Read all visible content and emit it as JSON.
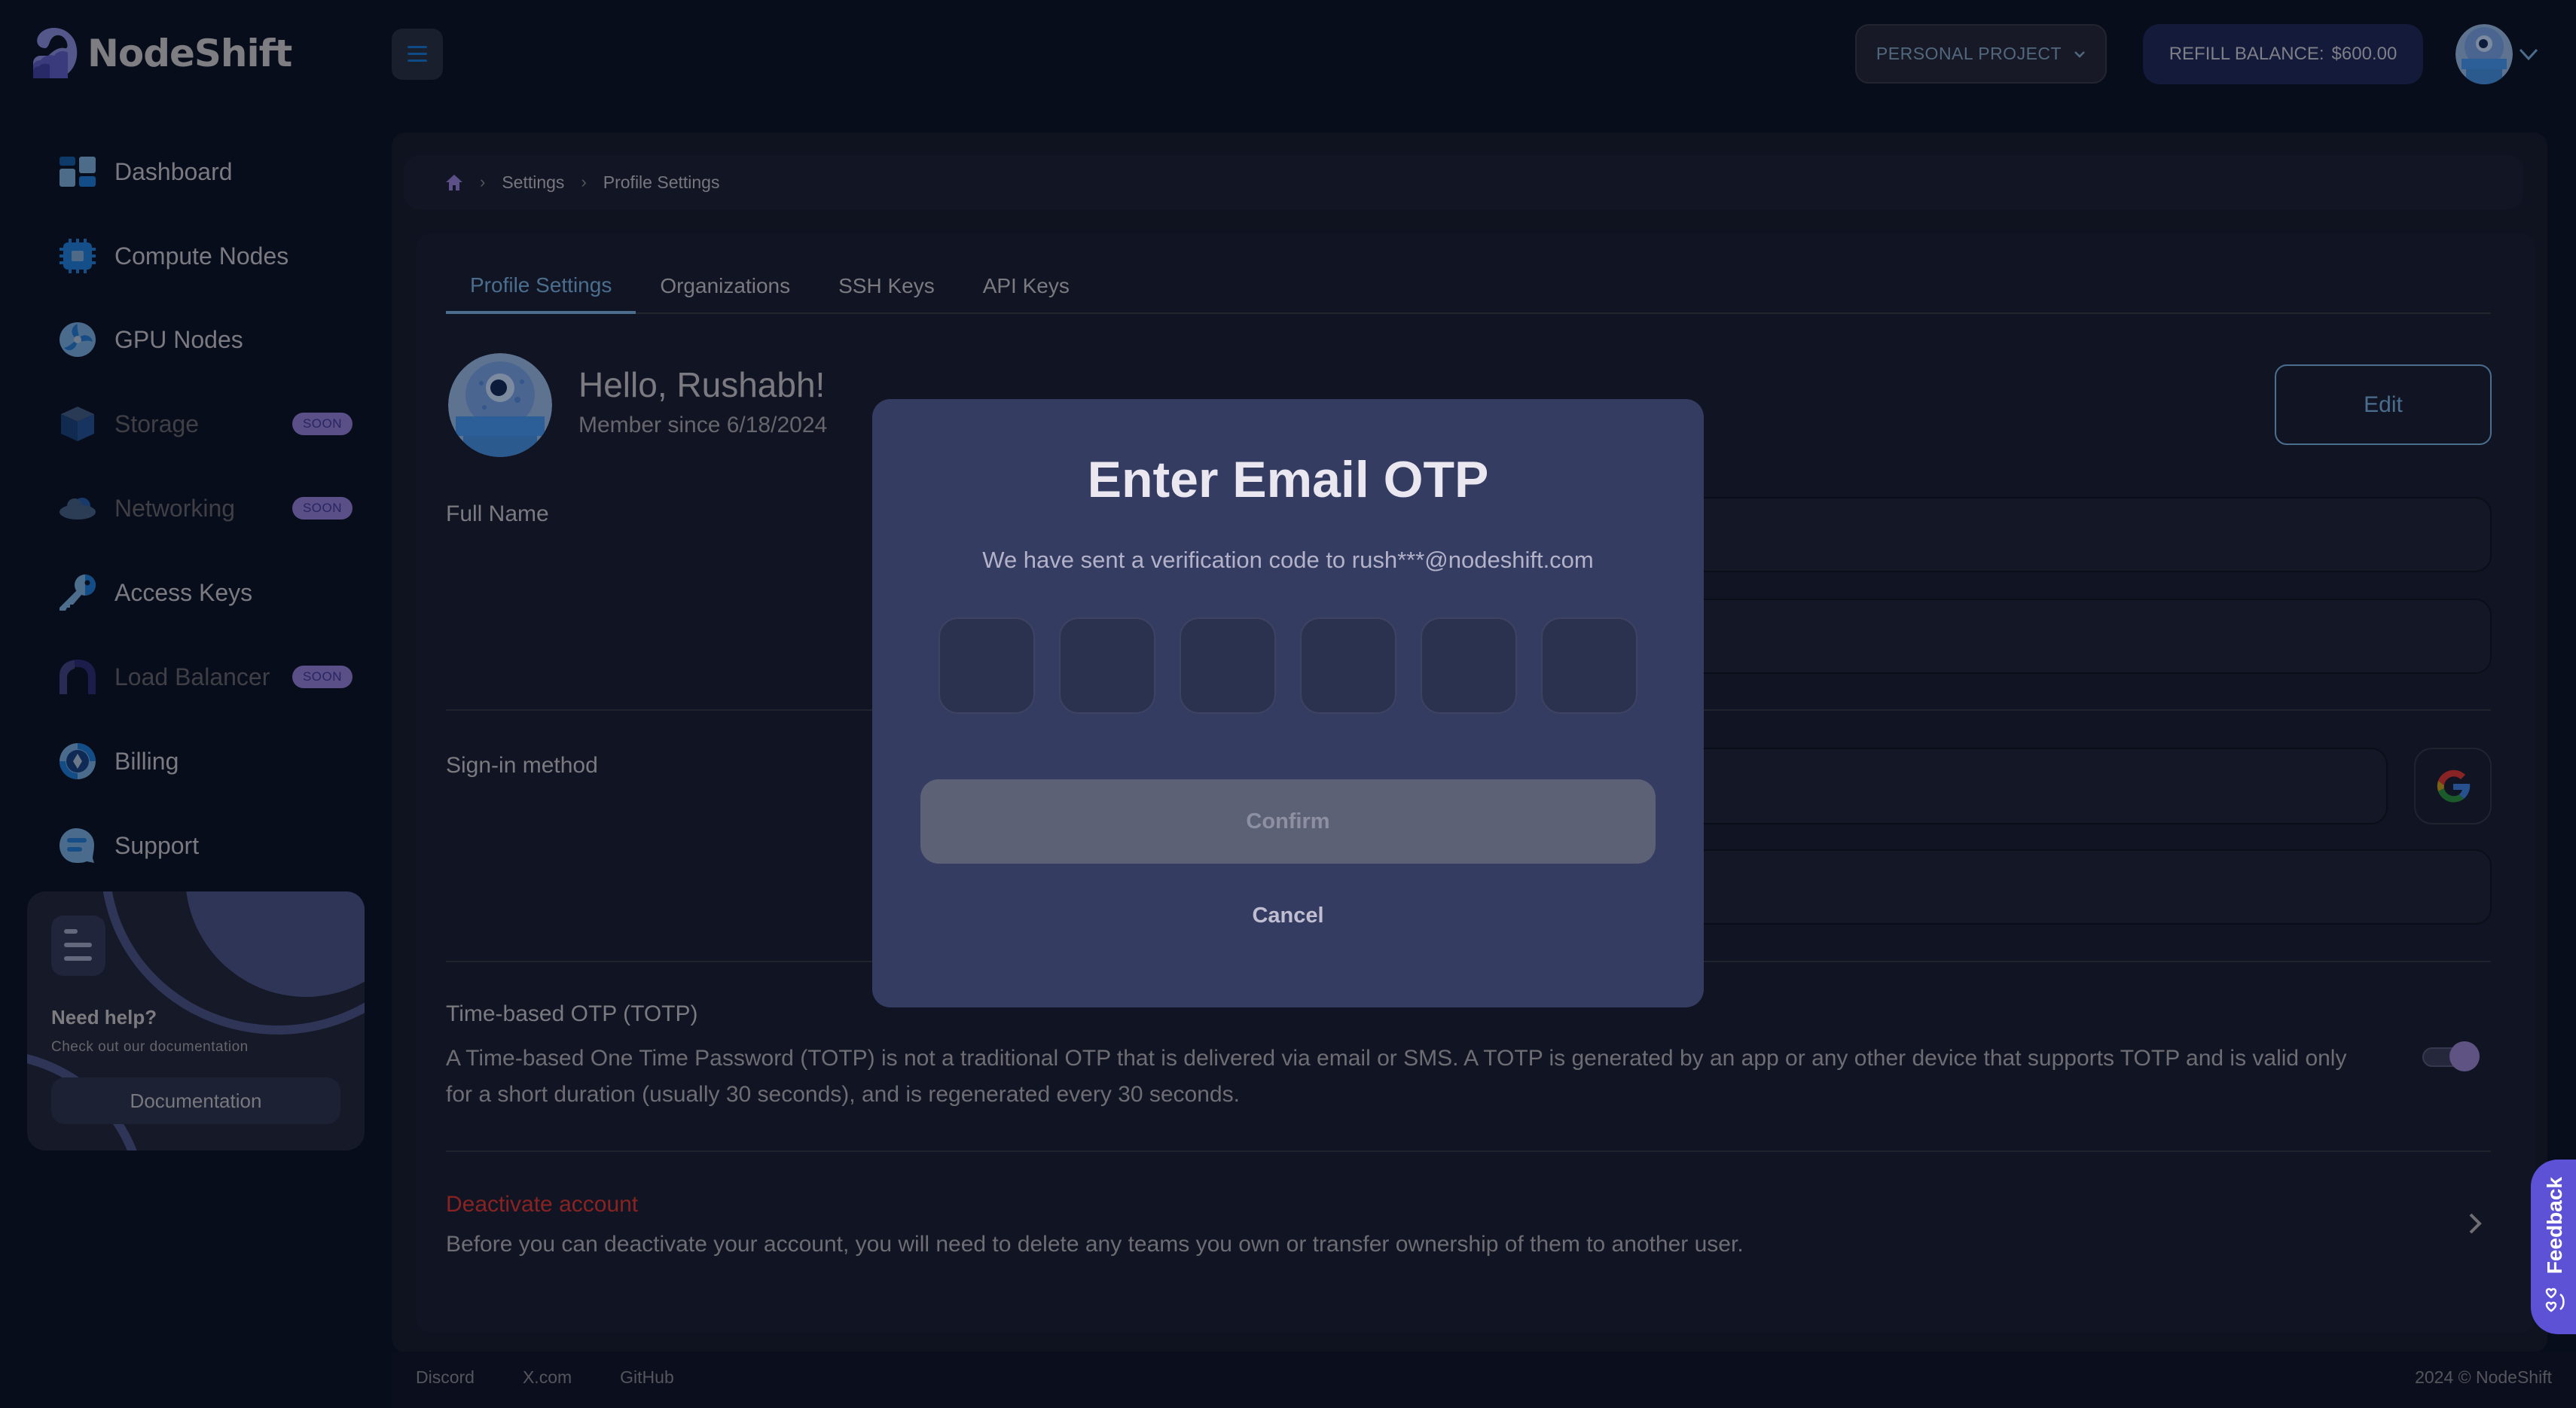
{
  "header": {
    "brand": "NodeShift",
    "project_selector": "PERSONAL PROJECT",
    "refill_label": "REFILL BALANCE:",
    "refill_amount": "$600.00"
  },
  "sidebar": {
    "items": [
      {
        "label": "Dashboard",
        "icon": "dashboard-icon",
        "badge": null
      },
      {
        "label": "Compute Nodes",
        "icon": "cpu-chip-icon",
        "badge": null
      },
      {
        "label": "GPU Nodes",
        "icon": "gpu-fan-icon",
        "badge": null
      },
      {
        "label": "Storage",
        "icon": "cube-icon",
        "badge": "SOON"
      },
      {
        "label": "Networking",
        "icon": "cloud-icon",
        "badge": "SOON"
      },
      {
        "label": "Access Keys",
        "icon": "key-icon",
        "badge": null
      },
      {
        "label": "Load Balancer",
        "icon": "load-balancer-icon",
        "badge": "SOON"
      },
      {
        "label": "Billing",
        "icon": "billing-icon",
        "badge": null
      },
      {
        "label": "Support",
        "icon": "chat-bubble-icon",
        "badge": null
      }
    ],
    "help": {
      "title": "Need help?",
      "subtitle": "Check out our documentation",
      "button": "Documentation"
    }
  },
  "breadcrumb": {
    "items": [
      "Settings",
      "Profile Settings"
    ]
  },
  "tabs": [
    {
      "label": "Profile Settings",
      "active": true
    },
    {
      "label": "Organizations",
      "active": false
    },
    {
      "label": "SSH Keys",
      "active": false
    },
    {
      "label": "API Keys",
      "active": false
    }
  ],
  "profile": {
    "greeting": "Hello, Rushabh!",
    "member_since": "Member since 6/18/2024",
    "edit_button": "Edit",
    "full_name_label": "Full Name",
    "signin_label": "Sign-in method",
    "totp_title": "Time-based OTP (TOTP)",
    "totp_description": "A Time-based One Time Password (TOTP) is not a traditional OTP that is delivered via email or SMS. A TOTP is generated by an app or any other device that supports TOTP and is valid only for a short duration (usually 30 seconds), and is regenerated every 30 seconds.",
    "totp_enabled": false,
    "deactivate_title": "Deactivate account",
    "deactivate_description": "Before you can deactivate your account, you will need to delete any teams you own or transfer ownership of them to another user."
  },
  "modal": {
    "title": "Enter Email OTP",
    "subtitle": "We have sent a verification code to rush***@nodeshift.com",
    "otp_digits": [
      "",
      "",
      "",
      "",
      "",
      ""
    ],
    "confirm_button": "Confirm",
    "cancel_button": "Cancel"
  },
  "footer": {
    "links": [
      "Discord",
      "X.com",
      "GitHub"
    ],
    "copyright": "2024 © NodeShift"
  },
  "feedback_tab": "Feedback",
  "colors": {
    "accent": "#4b6e8f",
    "modal_bg": "#343c62",
    "feedback": "#5d52d6",
    "danger": "#8a2222",
    "soon_badge": "#5a4f86"
  }
}
